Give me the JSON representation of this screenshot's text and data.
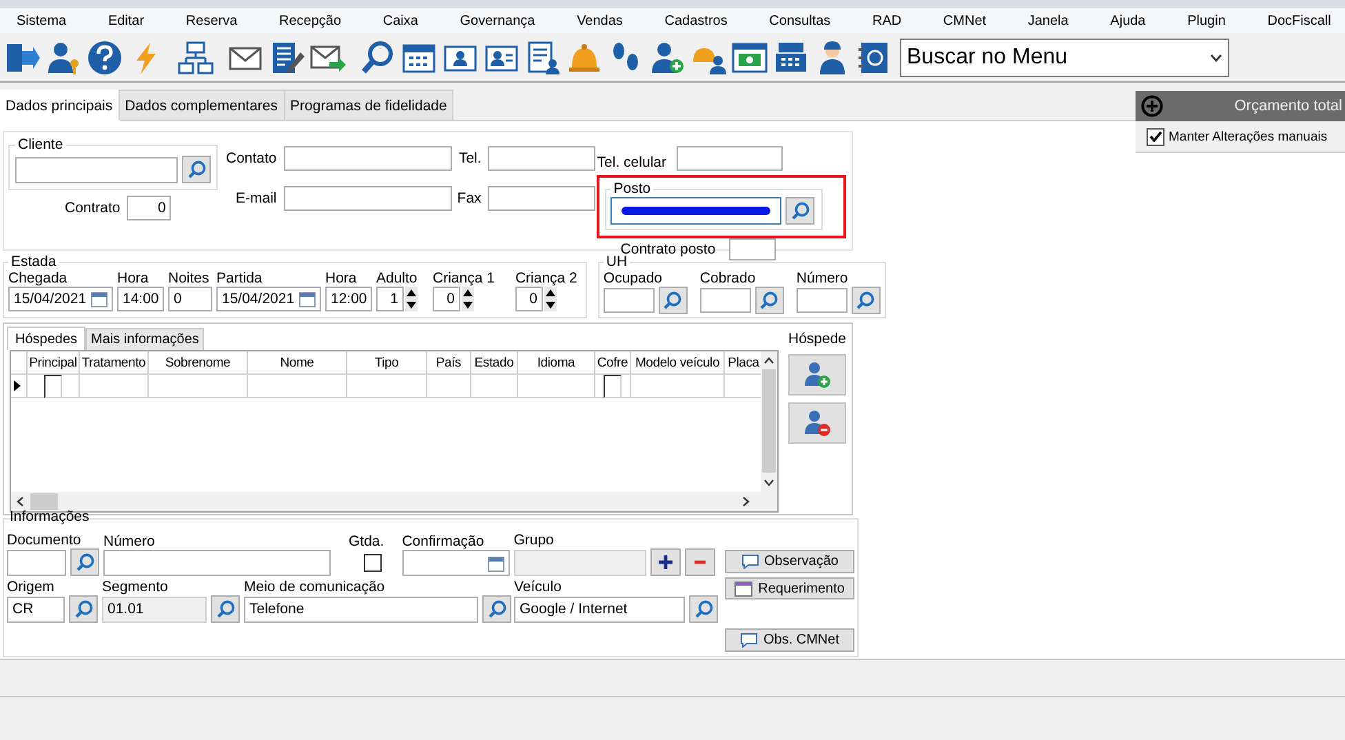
{
  "menu": [
    "Sistema",
    "Editar",
    "Reserva",
    "Recepção",
    "Caixa",
    "Governança",
    "Vendas",
    "Cadastros",
    "Consultas",
    "RAD",
    "CMNet",
    "Janela",
    "Ajuda",
    "Plugin",
    "DocFiscall"
  ],
  "menu_search": {
    "value": "Buscar no Menu"
  },
  "tabs": [
    {
      "label": "Dados principais",
      "selected": true
    },
    {
      "label": "Dados complementares",
      "selected": false
    },
    {
      "label": "Programas de fidelidade",
      "selected": false
    }
  ],
  "budget_panel": {
    "title": "Orçamento total",
    "checkbox": {
      "label": "Manter Alterações manuais",
      "checked": true
    }
  },
  "cliente": {
    "legend": "Cliente",
    "contrato": {
      "label": "Contrato",
      "value": "0"
    }
  },
  "contact_fields": [
    {
      "label": "Contato"
    },
    {
      "label": "E-mail"
    }
  ],
  "phone_fields": [
    {
      "label": "Tel."
    },
    {
      "label": "Fax"
    }
  ],
  "tel_celular": {
    "label": "Tel. celular"
  },
  "posto": {
    "legend": "Posto",
    "redacted": true,
    "highlighted": true
  },
  "contrato_posto": {
    "label": "Contrato posto"
  },
  "estada": {
    "legend": "Estada",
    "fields": [
      {
        "kind": "date",
        "label": "Chegada",
        "value": "15/04/2021"
      },
      {
        "kind": "text",
        "label": "Hora",
        "value": "14:00"
      },
      {
        "kind": "text",
        "label": "Noites",
        "value": "0"
      },
      {
        "kind": "date",
        "label": "Partida",
        "value": "15/04/2021"
      },
      {
        "kind": "text",
        "label": "Hora",
        "value": "12:00"
      },
      {
        "kind": "spin",
        "label": "Adulto",
        "value": "1"
      },
      {
        "kind": "spin",
        "label": "Criança 1",
        "value": "0"
      },
      {
        "kind": "spin",
        "label": "Criança 2",
        "value": "0"
      }
    ]
  },
  "uh": {
    "legend": "UH",
    "fields": [
      {
        "label": "Ocupado"
      },
      {
        "label": "Cobrado"
      },
      {
        "label": "Número"
      }
    ]
  },
  "guest_tabs": [
    {
      "label": "Hóspedes",
      "selected": true
    },
    {
      "label": "Mais informações",
      "selected": false
    }
  ],
  "guest_table": {
    "columns": [
      {
        "label": "Principal",
        "kind": "check"
      },
      {
        "label": "Tratamento",
        "kind": "text"
      },
      {
        "label": "Sobrenome",
        "kind": "text"
      },
      {
        "label": "Nome",
        "kind": "text"
      },
      {
        "label": "Tipo",
        "kind": "text"
      },
      {
        "label": "País",
        "kind": "text"
      },
      {
        "label": "Estado",
        "kind": "text"
      },
      {
        "label": "Idioma",
        "kind": "text"
      },
      {
        "label": "Cofre",
        "kind": "check"
      },
      {
        "label": "Modelo veículo",
        "kind": "text"
      },
      {
        "label": "Placa",
        "kind": "text"
      }
    ],
    "rows": [
      {
        "current": true,
        "checks": [
          false,
          false
        ]
      }
    ]
  },
  "guest_actions": {
    "label": "Hóspede"
  },
  "informacoes": {
    "legend": "Informações",
    "fields": [
      {
        "kind": "lookup",
        "label": "Documento"
      },
      {
        "kind": "text",
        "label": "Número"
      },
      {
        "kind": "check",
        "label": "Gtda.",
        "checked": false
      },
      {
        "kind": "date",
        "label": "Confirmação"
      },
      {
        "kind": "group",
        "label": "Grupo",
        "disabled": true
      },
      {
        "kind": "lookup",
        "label": "Origem",
        "value": "CR"
      },
      {
        "kind": "lookup",
        "label": "Segmento",
        "value": "01.01",
        "disabled": true
      },
      {
        "kind": "lookup",
        "label": "Meio de comunicação",
        "value": "Telefone"
      },
      {
        "kind": "lookup",
        "label": "Veículo",
        "value": "Google / Internet"
      }
    ],
    "buttons": [
      {
        "kind": "note",
        "label": "Observação"
      },
      {
        "kind": "request",
        "label": "Requerimento"
      },
      {
        "kind": "note",
        "label": "Obs. CMNet"
      }
    ]
  }
}
